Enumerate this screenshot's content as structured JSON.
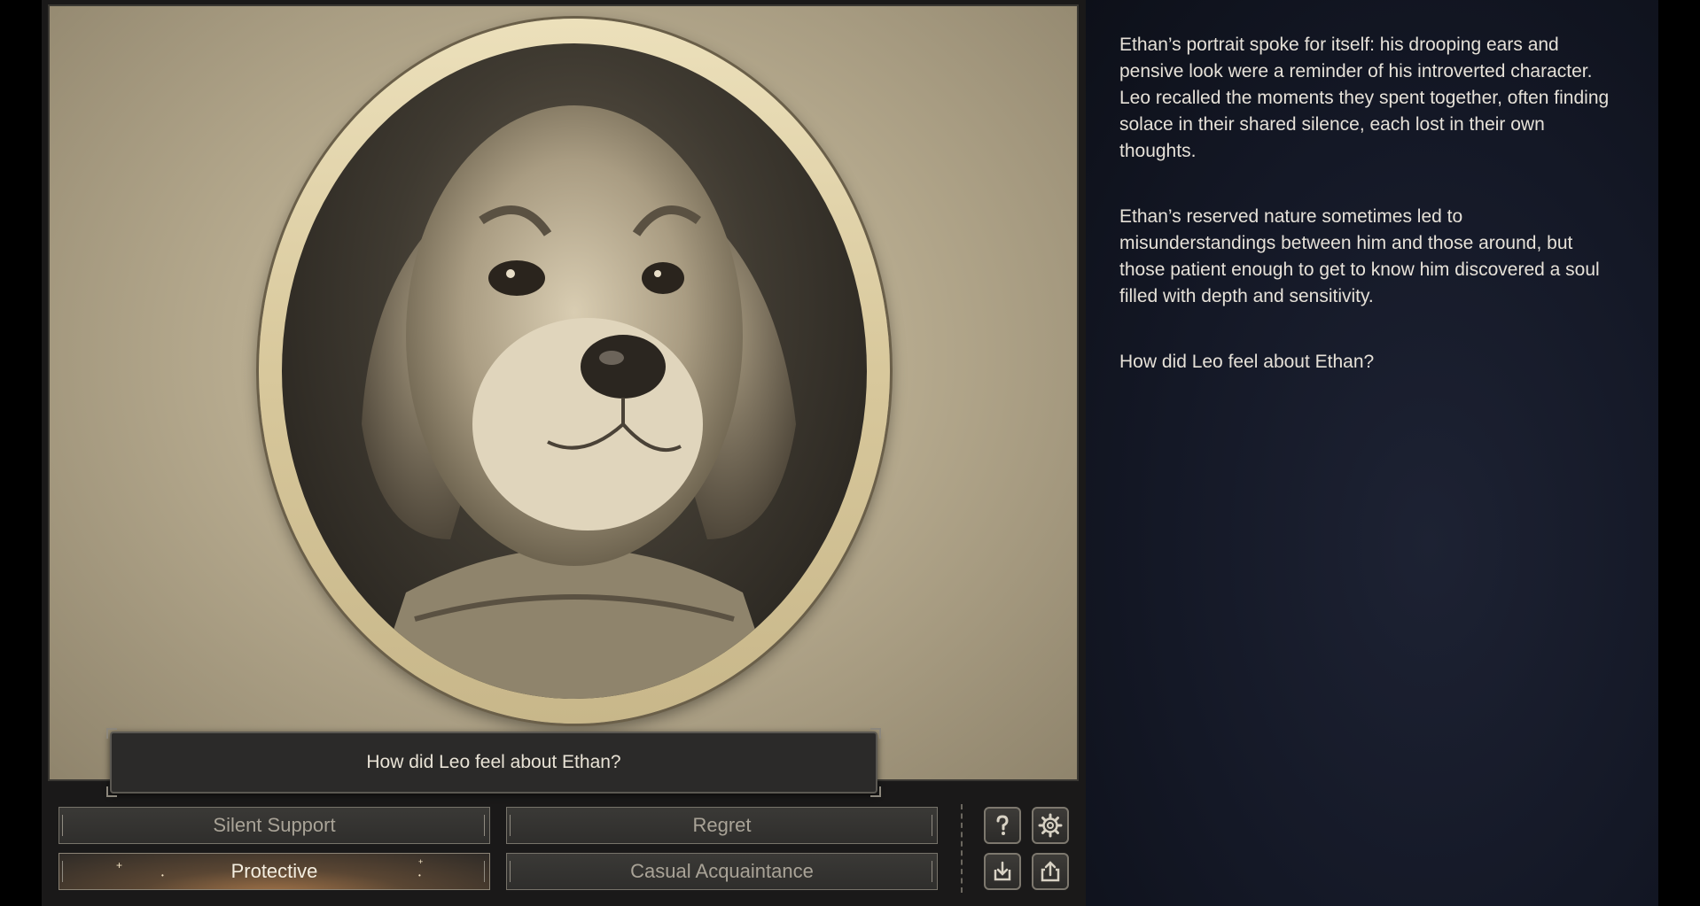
{
  "scene": {
    "portrait_icon": "dog-portrait-icon",
    "question": "How did Leo feel about Ethan?"
  },
  "choices": [
    {
      "label": "Silent Support",
      "selected": false
    },
    {
      "label": "Regret",
      "selected": false
    },
    {
      "label": "Protective",
      "selected": true
    },
    {
      "label": "Casual Acquaintance",
      "selected": false
    }
  ],
  "toolbar": {
    "help_icon": "question-mark-icon",
    "settings_icon": "gear-icon",
    "save_icon": "download-icon",
    "share_icon": "share-icon"
  },
  "narrative": {
    "paragraphs": [
      "Ethan’s portrait spoke for itself: his drooping ears and pensive look were a reminder of his introverted character. Leo recalled the moments they spent together, often finding solace in their shared silence, each lost in their own thoughts.",
      "Ethan’s reserved nature sometimes led to misunderstandings between him and those around, but those patient enough to get to know him discovered a soul filled with depth and sensitivity.",
      "How did Leo feel about Ethan?"
    ]
  },
  "colors": {
    "panel_bg": "#1a1919",
    "text_panel_bg": "#141826",
    "choice_text": "#a9a397",
    "selected_glow": "#a8774a"
  }
}
